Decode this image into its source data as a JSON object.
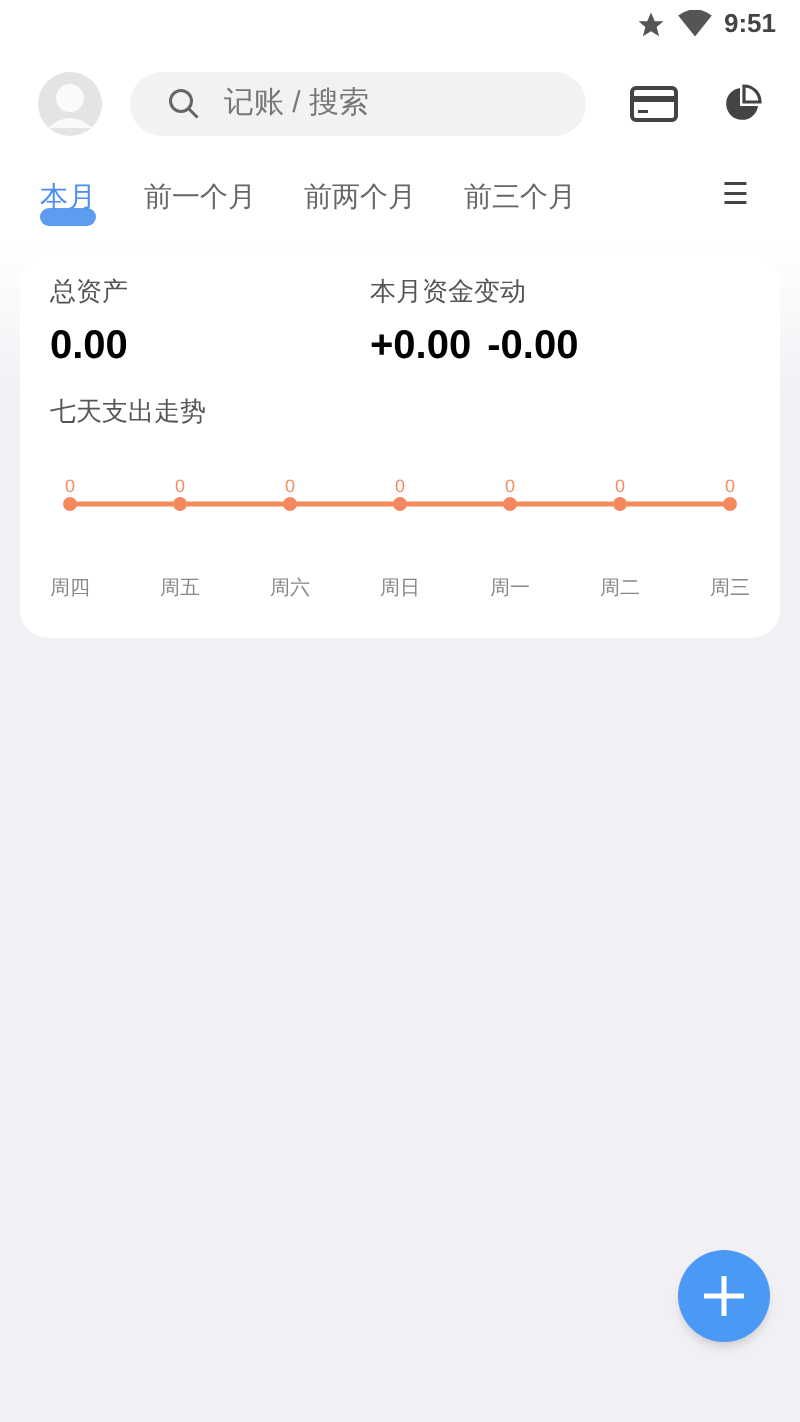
{
  "status_bar": {
    "time": "9:51"
  },
  "search": {
    "placeholder": "记账 / 搜索"
  },
  "tabs": [
    {
      "label": "本月",
      "selected": true
    },
    {
      "label": "前一个月",
      "selected": false
    },
    {
      "label": "前两个月",
      "selected": false
    },
    {
      "label": "前三个月",
      "selected": false
    }
  ],
  "menu_icon": "☰",
  "summary": {
    "total_assets_label": "总资产",
    "total_assets": "0.00",
    "monthly_change_label": "本月资金变动",
    "income": "+0.00",
    "expense": "-0.00"
  },
  "trend": {
    "title": "七天支出走势",
    "days": [
      {
        "day": "周四",
        "amount": "0"
      },
      {
        "day": "周五",
        "amount": "0"
      },
      {
        "day": "周六",
        "amount": "0"
      },
      {
        "day": "周日",
        "amount": "0"
      },
      {
        "day": "周一",
        "amount": "0"
      },
      {
        "day": "周二",
        "amount": "0"
      },
      {
        "day": "周三",
        "amount": "0"
      }
    ]
  }
}
